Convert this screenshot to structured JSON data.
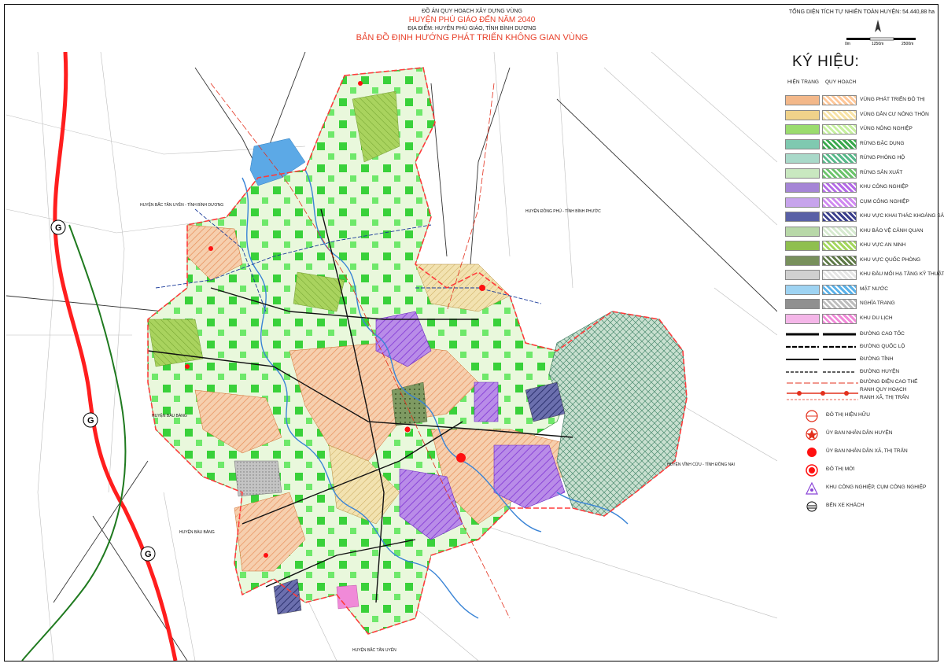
{
  "header": {
    "project": "ĐỒ ÁN QUY HOẠCH XÂY DỰNG VÙNG",
    "title": "HUYỆN PHÚ GIÁO ĐẾN NĂM 2040",
    "location": "ĐỊA ĐIỂM: HUYỆN PHÚ GIÁO, TỈNH BÌNH DƯƠNG",
    "map_title": "BẢN ĐỒ ĐỊNH HƯỚNG PHÁT TRIỂN KHÔNG GIAN VÙNG",
    "area_note": "TỔNG DIỆN TÍCH TỰ NHIÊN TOÀN HUYỆN: 54.440,88 ha",
    "scale": {
      "s0": "0m",
      "s1": "1250m",
      "s2": "2500m"
    }
  },
  "legend": {
    "title": "KÝ HIỆU:",
    "col_existing": "HIỆN TRẠNG",
    "col_planned": "QUY HOẠCH",
    "items": [
      {
        "label": "VÙNG PHÁT TRIỂN ĐÔ THỊ",
        "color": "#f3b88a",
        "planned": "#ffc89a"
      },
      {
        "label": "VÙNG DÂN CƯ NÔNG THÔN",
        "color": "#f0d28a",
        "planned": "#f7e3a6"
      },
      {
        "label": "VÙNG NÔNG NGHIỆP",
        "color": "#9bdc6e",
        "planned": "#c6f0a0"
      },
      {
        "label": "RỪNG ĐẶC DỤNG",
        "color": "#7fc9b0",
        "planned": "#3aa84d"
      },
      {
        "label": "RỪNG PHÒNG HỘ",
        "color": "#a9d9c9",
        "planned": "#58b98a"
      },
      {
        "label": "RỪNG SẢN XUẤT",
        "color": "#c9e8c0",
        "planned": "#6cc46c"
      },
      {
        "label": "KHU CÔNG NGHIỆP",
        "color": "#a585d6",
        "planned": "#b46be6"
      },
      {
        "label": "CỤM CÔNG NGHIỆP",
        "color": "#c7a4ec",
        "planned": "#d08af0"
      },
      {
        "label": "KHU VỰC KHAI THÁC KHOÁNG SẢN VLXD",
        "color": "#5960a6",
        "planned": "#3a3f8c"
      },
      {
        "label": "KHU BẢO VỆ CẢNH QUAN",
        "color": "#b8d8a8",
        "planned": "#d6ead0"
      },
      {
        "label": "KHU VỰC AN NINH",
        "color": "#8fbf4f",
        "planned": "#a4d65e"
      },
      {
        "label": "KHU VỰC QUỐC PHÒNG",
        "color": "#78905c",
        "planned": "#5f7a48"
      },
      {
        "label": "KHU ĐẦU MỐI HẠ TẦNG KỸ THUẬT",
        "color": "#d0d0d0",
        "planned": "#e4e4e4"
      },
      {
        "label": "MẶT NƯỚC",
        "color": "#9ed3f2",
        "planned": "#5bb1e8"
      },
      {
        "label": "NGHĨA TRANG",
        "color": "#909090",
        "planned": "#bdbdbd"
      },
      {
        "label": "KHU DU LỊCH",
        "color": "#f4b6e8",
        "planned": "#f08ad8"
      }
    ],
    "roads": [
      {
        "label": "ĐƯỜNG CAO TỐC"
      },
      {
        "label": "ĐƯỜNG QUỐC LỘ"
      },
      {
        "label": "ĐƯỜNG TỈNH"
      },
      {
        "label": "ĐƯỜNG HUYỆN"
      }
    ],
    "powerline_label": "ĐƯỜNG ĐIỆN CAO THẾ",
    "boundary_labels": [
      "RANH QUY HOẠCH",
      "RANH XÃ, THỊ TRẤN"
    ],
    "symbols": [
      {
        "label": "ĐÔ THỊ HIỆN HỮU"
      },
      {
        "label": "ỦY BAN NHÂN DÂN HUYỆN"
      },
      {
        "label": "ỦY BAN NHÂN DÂN XÃ, THỊ TRẤN"
      },
      {
        "label": "ĐÔ THỊ MỚI"
      },
      {
        "label": "KHU CÔNG NGHIỆP, CỤM CÔNG NGHIỆP"
      },
      {
        "label": "BẾN XE KHÁCH"
      }
    ]
  },
  "map": {
    "expressway_marker": "G",
    "neighbors": [
      "HUYỆN BẮC TÂN UYÊN - TỈNH BÌNH DƯƠNG",
      "HUYỆN ĐỒNG PHÚ - TỈNH BÌNH PHƯỚC",
      "HUYỆN BÀU BÀNG",
      "HUYỆN BÀU BÀNG",
      "HUYỆN VĨNH CỬU - TỈNH ĐỒNG NAI",
      "HUYỆN BẮC TÂN UYÊN"
    ]
  }
}
